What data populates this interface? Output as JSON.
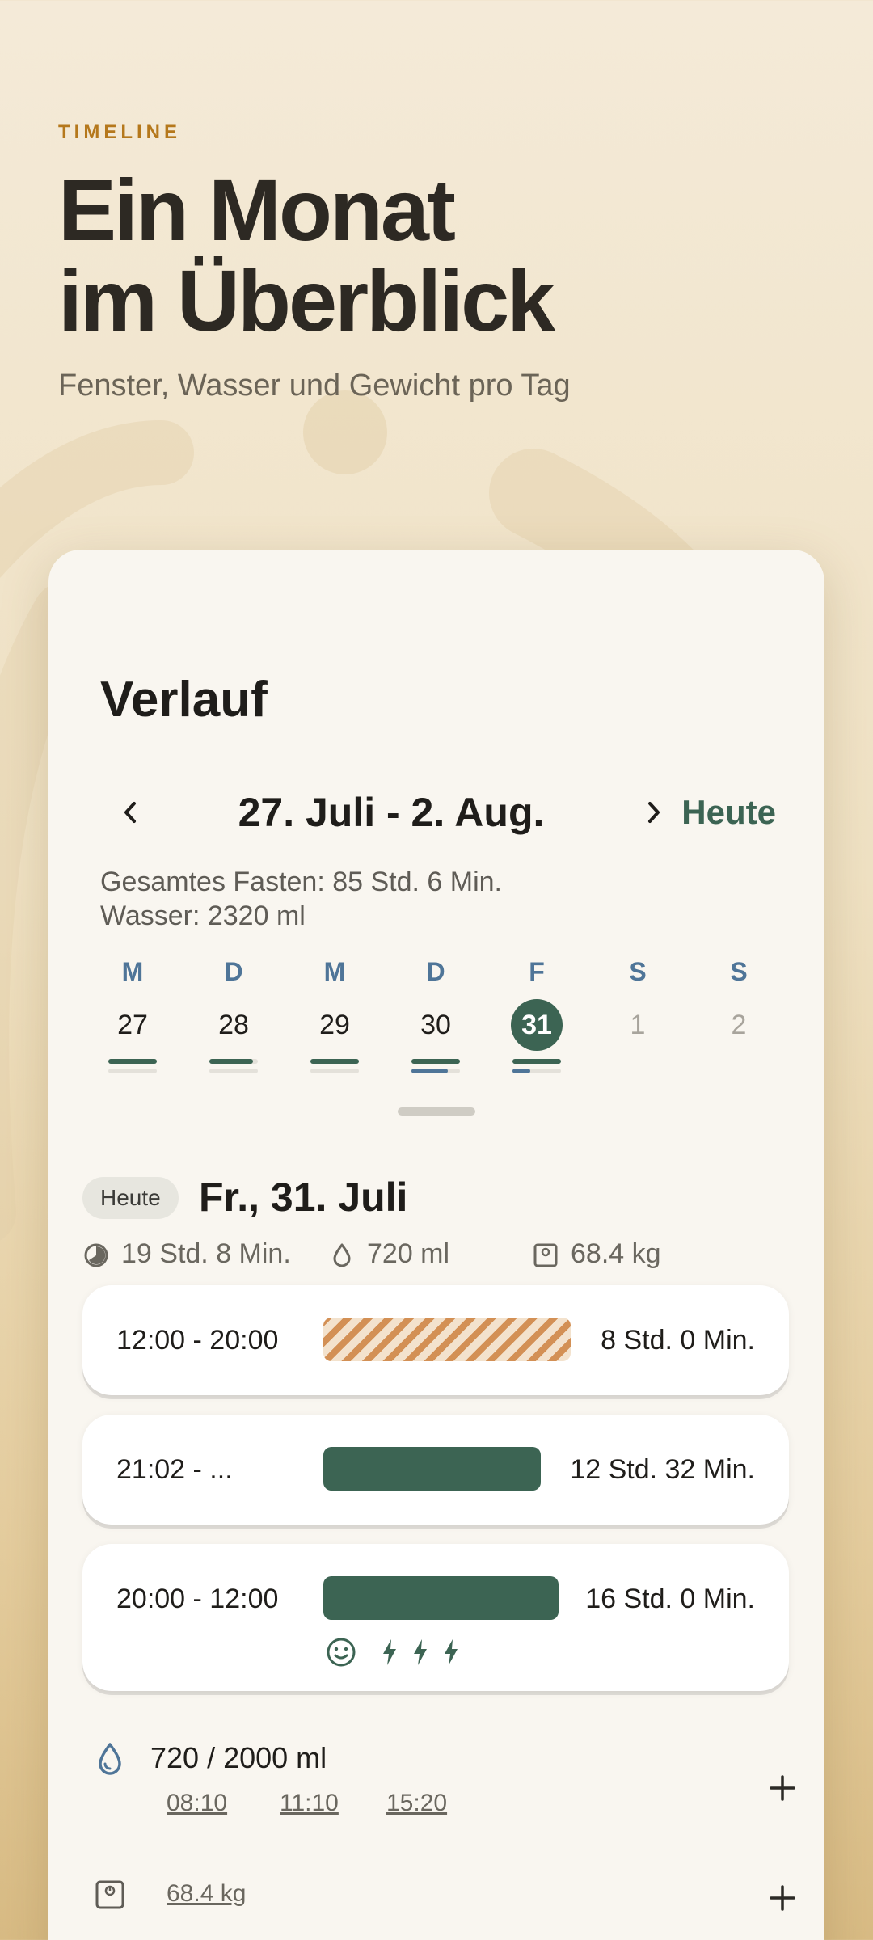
{
  "promo": {
    "eyebrow": "TIMELINE",
    "headline_line1": "Ein Monat",
    "headline_line2": "im Überblick",
    "subline": "Fenster, Wasser und Gewicht pro Tag"
  },
  "card": {
    "title": "Verlauf",
    "week_range": "27. Juli - 2. Aug.",
    "today_button": "Heute",
    "summary_total": "Gesamtes Fasten: 85 Std. 6 Min.",
    "summary_water": "Wasser: 2320 ml",
    "days": [
      {
        "letter": "M",
        "num": "27",
        "state": "past",
        "fast_progress": 1.0,
        "water_progress": 0.0
      },
      {
        "letter": "D",
        "num": "28",
        "state": "past",
        "fast_progress": 0.9,
        "water_progress": 0.0
      },
      {
        "letter": "M",
        "num": "29",
        "state": "past",
        "fast_progress": 1.0,
        "water_progress": 0.0
      },
      {
        "letter": "D",
        "num": "30",
        "state": "past",
        "fast_progress": 1.0,
        "water_progress": 0.75
      },
      {
        "letter": "F",
        "num": "31",
        "state": "selected",
        "fast_progress": 1.0,
        "water_progress": 0.36
      },
      {
        "letter": "S",
        "num": "1",
        "state": "future",
        "fast_progress": 0.0,
        "water_progress": 0.0
      },
      {
        "letter": "S",
        "num": "2",
        "state": "future",
        "fast_progress": 0.0,
        "water_progress": 0.0
      }
    ],
    "detail": {
      "today_chip": "Heute",
      "date_title": "Fr., 31. Juli",
      "fasting_total": "19 Std. 8 Min.",
      "water_total": "720 ml",
      "weight": "68.4 kg"
    },
    "entries": [
      {
        "time": "12:00 - 20:00",
        "duration": "8 Std. 0 Min.",
        "style": "eating",
        "fill": 1.0
      },
      {
        "time": "21:02 - ...",
        "duration": "12 Std. 32 Min.",
        "style": "fasting",
        "fill": 0.88
      },
      {
        "time": "20:00 - 12:00",
        "duration": "16 Std. 0 Min.",
        "style": "fasting",
        "fill": 0.95,
        "mood": "smile-icon",
        "energy": 3
      }
    ],
    "water": {
      "label": "720 / 2000 ml",
      "times": [
        "08:10",
        "11:10",
        "15:20"
      ]
    },
    "weight_entry": "68.4 kg"
  },
  "colors": {
    "accent_green": "#3c6453",
    "eyebrow_orange": "#b5781c",
    "water_blue": "#4f7598",
    "eating_orange": "#d39055"
  }
}
